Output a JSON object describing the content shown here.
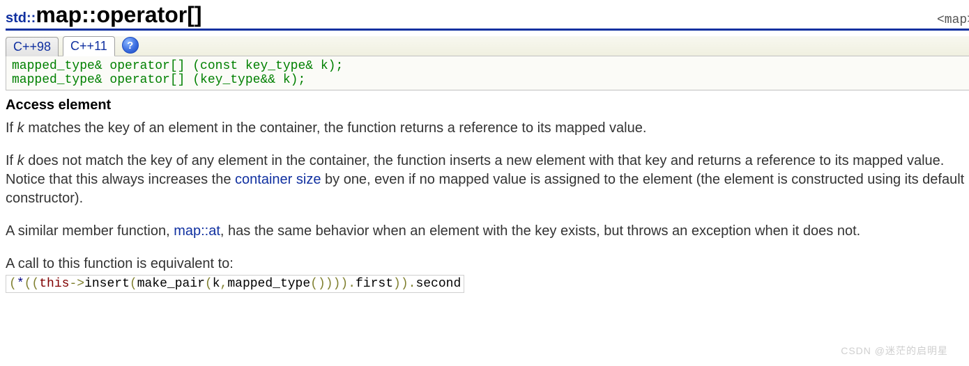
{
  "header": {
    "ns": "std::",
    "cls": "map",
    "sep": "::",
    "member": "operator[]",
    "include": "<map>"
  },
  "tabs": {
    "cpp98": "C++98",
    "cpp11": "C++11",
    "help": "?"
  },
  "signature": "mapped_type& operator[] (const key_type& k);\nmapped_type& operator[] (key_type&& k);",
  "section_title": "Access element",
  "para1": {
    "pre": "If ",
    "var": "k",
    "post": " matches the key of an element in the container, the function returns a reference to its mapped value."
  },
  "para2": {
    "pre": "If ",
    "var": "k",
    "mid1": " does not match the key of any element in the container, the function inserts a new element with that key and returns a reference to its mapped value. Notice that this always increases the ",
    "link": "container size",
    "mid2": " by one, even if no mapped value is assigned to the element (the element is constructed using its default constructor)."
  },
  "para3": {
    "pre": "A similar member function, ",
    "link": "map::at",
    "post": ", has the same behavior when an element with the key exists, but throws an exception when it does not."
  },
  "para4": "A call to this function is equivalent to:",
  "equiv": {
    "t1_delim": "(",
    "t2_star": "*",
    "t3_delim": "((",
    "t4_kw": "this",
    "t5_arrow": "->",
    "t6_plain": "insert",
    "t7_delim": "(",
    "t8_plain": "make_pair",
    "t9_delim": "(",
    "t10_plain": "k",
    "t11_delim": ",",
    "t12_plain": "mapped_type",
    "t13_delim": "())))",
    "t14_delim": ".",
    "t15_plain": "first",
    "t16_delim": "))",
    "t17_delim": ".",
    "t18_plain": "second"
  },
  "watermark": "CSDN @迷茫的启明星"
}
